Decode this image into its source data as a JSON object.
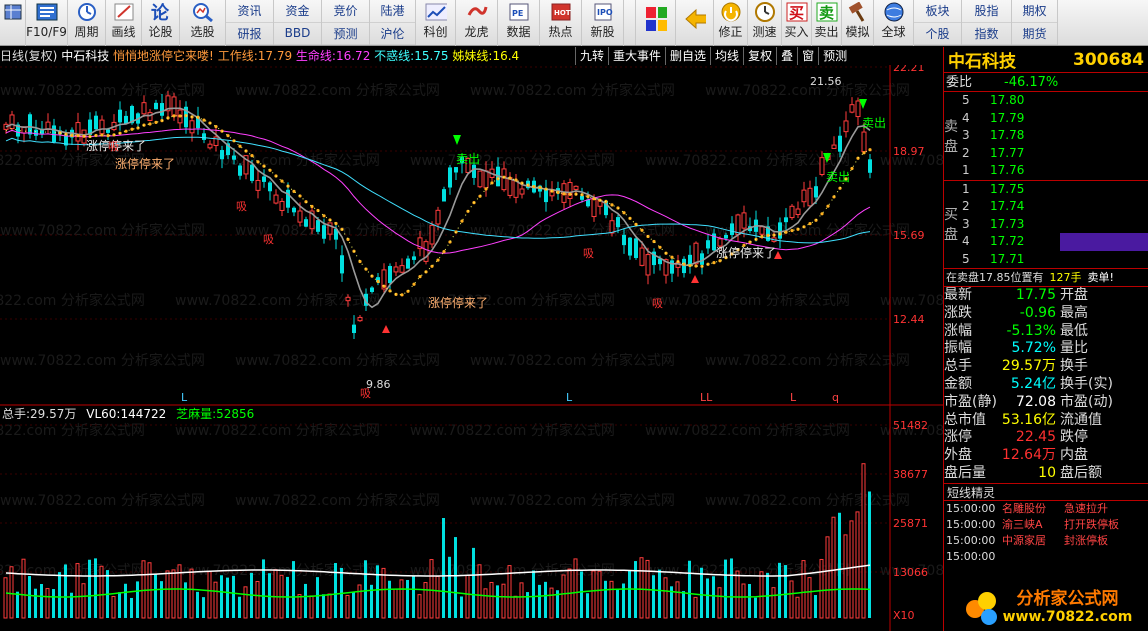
{
  "toolbar": {
    "items": [
      {
        "label": "",
        "icon": "grid-icon"
      },
      {
        "label": "F10/F9",
        "icon": "info-icon"
      },
      {
        "label": "周期",
        "icon": "period-icon"
      },
      {
        "label": "画线",
        "icon": "draw-icon"
      },
      {
        "label": "论股",
        "icon": "discuss-icon"
      },
      {
        "label": "选股",
        "icon": "select-stock-icon"
      }
    ],
    "pairs": [
      [
        "资讯",
        "研报"
      ],
      [
        "资金",
        "BBD"
      ],
      [
        "竞价",
        "预测"
      ],
      [
        "陆港",
        "沪伦"
      ]
    ],
    "items2": [
      {
        "label": "科创",
        "icon": "kechuang-icon"
      },
      {
        "label": "龙虎",
        "icon": "dragon-tiger-icon"
      },
      {
        "label": "数据",
        "icon": "data-icon"
      },
      {
        "label": "热点",
        "icon": "hotspot-icon"
      },
      {
        "label": "新股",
        "icon": "ipo-icon"
      }
    ],
    "items3": [
      {
        "label": "",
        "icon": "windows-icon"
      },
      {
        "label": "",
        "icon": "back-arrow-icon"
      },
      {
        "label": "修正",
        "icon": "fix-icon"
      },
      {
        "label": "测速",
        "icon": "speed-test-icon"
      },
      {
        "label": "买入",
        "icon": "buy-icon"
      },
      {
        "label": "卖出",
        "icon": "sell-icon"
      },
      {
        "label": "模拟",
        "icon": "simulate-icon"
      },
      {
        "label": "全球",
        "icon": "globe-icon"
      }
    ],
    "pairs2": [
      [
        "板块",
        "个股"
      ],
      [
        "股指",
        "指数"
      ],
      [
        "期权",
        "期货"
      ]
    ],
    "buy_glyph": "买",
    "sell_glyph": "卖"
  },
  "infobar": {
    "period": "日线(复权)",
    "stock": "中石科技",
    "slogan": "悄悄地涨停它来喽!",
    "l1_name": "工作线:",
    "l1_val": "17.79",
    "l2_name": "生命线:",
    "l2_val": "16.72",
    "l3_name": "不惑线:",
    "l3_val": "15.75",
    "l4_name": "姊妹线:",
    "l4_val": "16.4"
  },
  "tabs": [
    "九转",
    "重大事件",
    "删自选",
    "均线",
    "复权",
    "叠",
    "窗",
    "预测"
  ],
  "watermark": "www.70822.com 分析家公式网",
  "price_axis": [
    "22.21",
    "18.97",
    "15.69",
    "12.44"
  ],
  "vol_axis": [
    "51482",
    "38677",
    "25871",
    "13066",
    "X10"
  ],
  "annotations": {
    "high_label": "21.56",
    "low_label": "9.86",
    "sell1": "卖出",
    "sell2": "卖出",
    "sell3": "卖出",
    "limit1": "涨停停来了",
    "limit2": "涨停停来了",
    "limit3": "涨停停来了",
    "limit4": "涨停停来了",
    "absorb1": "吸",
    "absorb2": "吸",
    "absorb3": "吸",
    "absorb4": "吸",
    "absorb5": "吸",
    "absorb6": "吸",
    "l_markers": [
      "L",
      "L",
      "LL",
      "L",
      "q"
    ]
  },
  "vol_info": {
    "total_name": "总手:",
    "total_val": "29.57万",
    "vl60_name": "VL60:",
    "vl60_val": "144722",
    "sesame_name": "芝麻量:",
    "sesame_val": "52856"
  },
  "panel": {
    "name": "中石科技",
    "code": "300684",
    "weibi_label": "委比",
    "weibi_val": "-46.17%",
    "sell_side": "卖盘",
    "buy_side": "买盘",
    "asks": [
      {
        "lvl": "5",
        "price": "17.80"
      },
      {
        "lvl": "4",
        "price": "17.79"
      },
      {
        "lvl": "3",
        "price": "17.78"
      },
      {
        "lvl": "2",
        "price": "17.77"
      },
      {
        "lvl": "1",
        "price": "17.76"
      }
    ],
    "bids": [
      {
        "lvl": "1",
        "price": "17.75"
      },
      {
        "lvl": "2",
        "price": "17.74"
      },
      {
        "lvl": "3",
        "price": "17.73"
      },
      {
        "lvl": "4",
        "price": "17.72"
      },
      {
        "lvl": "5",
        "price": "17.71"
      }
    ],
    "in_sell": "在卖盘17.85位置有",
    "in_sell_qty": "127手",
    "in_sell_tag": "卖单!",
    "stats": [
      {
        "k": "最新",
        "v": "17.75",
        "c": "#00ff00",
        "k2": "开盘"
      },
      {
        "k": "涨跌",
        "v": "-0.96",
        "c": "#00ff00",
        "k2": "最高"
      },
      {
        "k": "涨幅",
        "v": "-5.13%",
        "c": "#00ff00",
        "k2": "最低"
      },
      {
        "k": "振幅",
        "v": "5.72%",
        "c": "#00ffff",
        "k2": "量比"
      },
      {
        "k": "总手",
        "v": "29.57万",
        "c": "#ffff00",
        "k2": "换手"
      },
      {
        "k": "金额",
        "v": "5.24亿",
        "c": "#00ffff",
        "k2": "换手(实)"
      },
      {
        "k": "市盈(静)",
        "v": "72.08",
        "c": "#ffffff",
        "k2": "市盈(动)"
      },
      {
        "k": "总市值",
        "v": "53.16亿",
        "c": "#ffff00",
        "k2": "流通值"
      },
      {
        "k": "涨停",
        "v": "22.45",
        "c": "#ff3030",
        "k2": "跌停"
      },
      {
        "k": "外盘",
        "v": "12.64万",
        "c": "#ff3030",
        "k2": "内盘"
      },
      {
        "k": "盘后量",
        "v": "10",
        "c": "#ffff00",
        "k2": "盘后额"
      }
    ],
    "news_head": "短线精灵",
    "news": [
      {
        "t": "15:00:00",
        "a": "名雕股份",
        "b": "急速拉升"
      },
      {
        "t": "15:00:00",
        "a": "渝三峡A",
        "b": "打开跌停板"
      },
      {
        "t": "15:00:00",
        "a": "中源家居",
        "b": "封涨停板"
      },
      {
        "t": "15:00:00",
        "a": "",
        "b": ""
      }
    ],
    "logo_text": "分析家公式网",
    "logo_url": "www.70822.com"
  }
}
